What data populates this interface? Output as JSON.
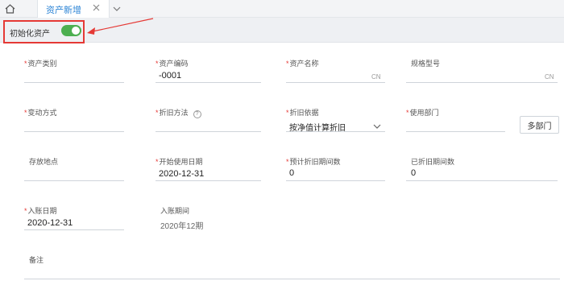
{
  "tabs": {
    "active_label": "资产新增"
  },
  "toolbar": {
    "init_label": "初始化资产",
    "init_toggle_on": true
  },
  "colors": {
    "accent": "#2f86d6",
    "toggle_on": "#4caf50",
    "required": "#e53935",
    "highlight_box": "#e53935"
  },
  "form": {
    "asset_category": {
      "label": "资产类别",
      "value": ""
    },
    "asset_code": {
      "label": "资产编码",
      "value": "-0001"
    },
    "asset_name": {
      "label": "资产名称",
      "value": "",
      "suffix": "CN"
    },
    "spec_model": {
      "label": "规格型号",
      "value": "",
      "suffix": "CN"
    },
    "change_method": {
      "label": "变动方式",
      "value": ""
    },
    "depr_method": {
      "label": "折旧方法",
      "value": ""
    },
    "depr_basis": {
      "label": "折旧依据",
      "value": "按净值计算折旧"
    },
    "use_dept": {
      "label": "使用部门",
      "value": ""
    },
    "multi_dept_button": "多部门",
    "location": {
      "label": "存放地点",
      "value": ""
    },
    "start_date": {
      "label": "开始使用日期",
      "value": "2020-12-31"
    },
    "est_periods": {
      "label": "预计折旧期间数",
      "value": "0"
    },
    "used_periods": {
      "label": "已折旧期间数",
      "value": "0"
    },
    "entry_date": {
      "label": "入账日期",
      "value": "2020-12-31"
    },
    "entry_period": {
      "label": "入账期间",
      "value": "2020年12期"
    },
    "remark": {
      "label": "备注",
      "value": ""
    }
  }
}
